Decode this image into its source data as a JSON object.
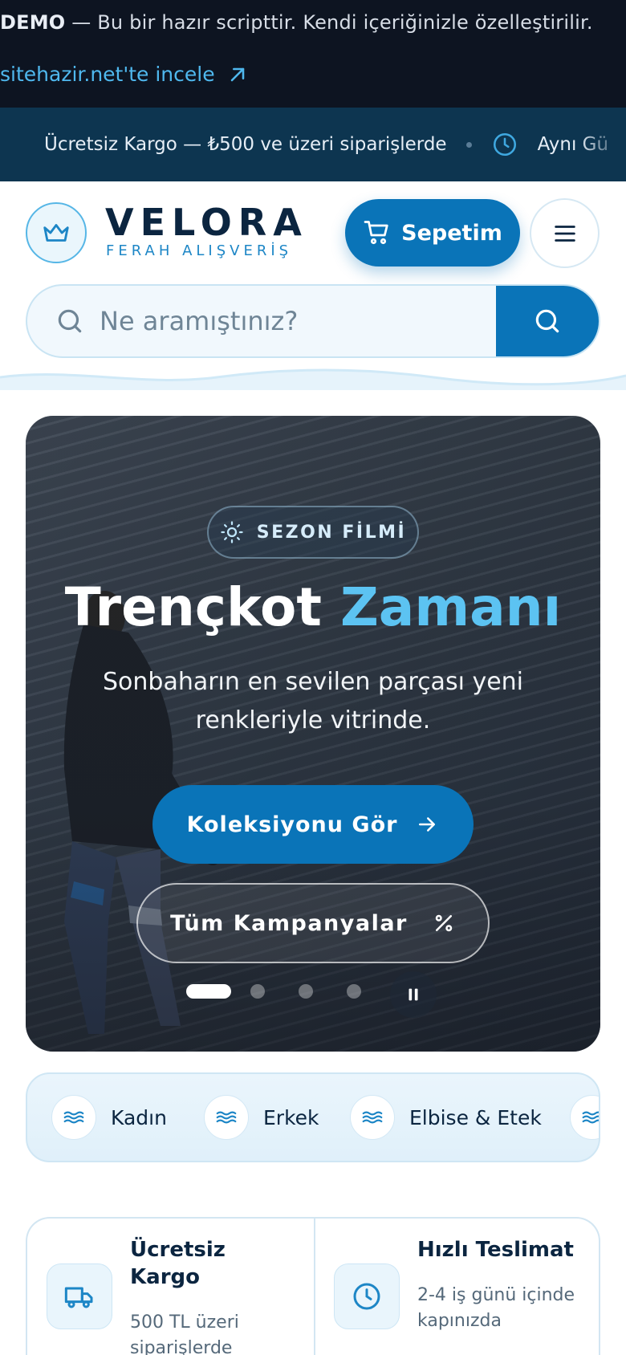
{
  "demo_bar": {
    "label": "DEMO",
    "text": " — Bu bir hazır scripttir. Kendi içeriğinizle özelleştirilir.",
    "link": "sitehazir.net'te incele"
  },
  "marquee": {
    "item1": "Ücretsiz Kargo — ₺500 ve üzeri siparişlerde",
    "item2": "Aynı Gü"
  },
  "header": {
    "logo_word": "VELORA",
    "logo_sub": "FERAH ALIŞVERİŞ",
    "cart_label": "Sepetim"
  },
  "search": {
    "placeholder": "Ne aramıştınız?"
  },
  "hero": {
    "badge": "SEZON FİLMİ",
    "title_main": "Trençkot ",
    "title_accent": "Zamanı",
    "subtitle": "Sonbaharın en sevilen parçası yeni renkleriyle vitrinde.",
    "cta_primary": "Koleksiyonu Gör",
    "cta_secondary": "Tüm Kampanyalar",
    "slide_count": 4,
    "active_slide": 1
  },
  "categories": [
    {
      "label": "Kadın"
    },
    {
      "label": "Erkek"
    },
    {
      "label": "Elbise & Etek"
    }
  ],
  "features": [
    {
      "title": "Ücretsiz Kargo",
      "desc": "500 TL üzeri siparişlerde"
    },
    {
      "title": "Hızlı Teslimat",
      "desc": "2-4 iş günü içinde kapınızda"
    }
  ],
  "colors": {
    "accent": "#0a74b8",
    "accent_light": "#5cc3f2",
    "dark": "#0b2540",
    "demo_bg": "#0d1421",
    "marquee_bg": "#0d3550"
  }
}
